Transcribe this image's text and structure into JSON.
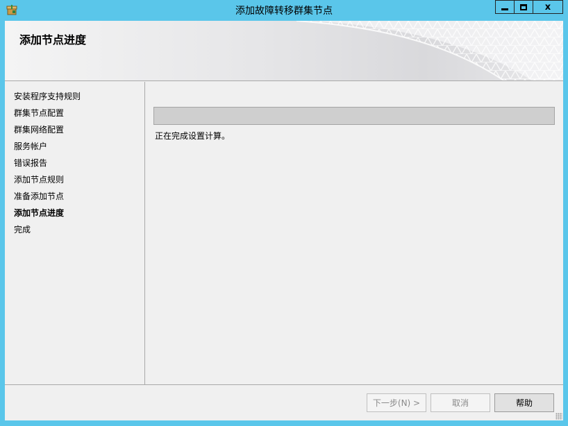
{
  "window": {
    "title": "添加故障转移群集节点",
    "close_label": "x",
    "colors": {
      "frame": "#5ac6ea",
      "client": "#f0f0f0",
      "progress_track": "#cfcfcf"
    }
  },
  "header": {
    "page_title": "添加节点进度"
  },
  "sidebar": {
    "items": [
      {
        "label": "安装程序支持规则",
        "active": false
      },
      {
        "label": "群集节点配置",
        "active": false
      },
      {
        "label": "群集网络配置",
        "active": false
      },
      {
        "label": "服务帐户",
        "active": false
      },
      {
        "label": "错误报告",
        "active": false
      },
      {
        "label": "添加节点规则",
        "active": false
      },
      {
        "label": "准备添加节点",
        "active": false
      },
      {
        "label": "添加节点进度",
        "active": true
      },
      {
        "label": "完成",
        "active": false
      }
    ]
  },
  "main": {
    "progress_fraction": 0,
    "status_text": "正在完成设置计算。"
  },
  "footer": {
    "next_label": "下一步(N) >",
    "cancel_label": "取消",
    "help_label": "帮助"
  },
  "icons": [
    "app-installer-icon",
    "minimize-icon",
    "maximize-icon",
    "resize-grip-icon"
  ]
}
